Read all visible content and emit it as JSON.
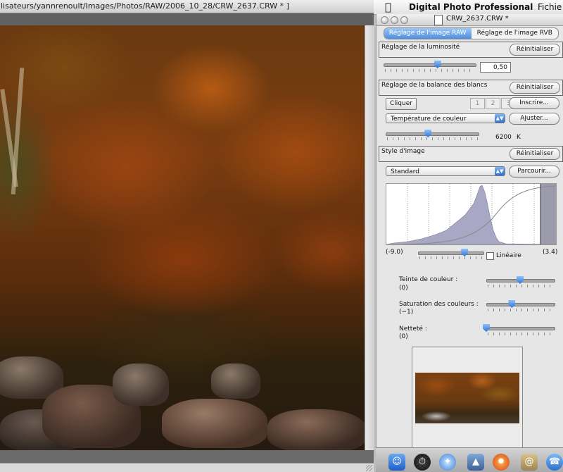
{
  "image_window": {
    "title": "lisateurs/yannrenoult/Images/Photos/RAW/2006_10_28/CRW_2637.CRW * ]"
  },
  "menubar": {
    "app_name": "Digital Photo Professional",
    "file_menu": "Fichie"
  },
  "palette": {
    "title": "CRW_2637.CRW *",
    "tabs": [
      "Réglage de l'image RAW",
      "Réglage de l'image RVB"
    ],
    "active_tab": 0,
    "brightness": {
      "label": "Réglage de la luminosité",
      "reset": "Réinitialiser",
      "value": "0,50",
      "slider_fraction": 0.59
    },
    "white_balance": {
      "label": "Réglage de la balance des blancs",
      "reset": "Réinitialiser",
      "click": "Cliquer",
      "presets": [
        "1",
        "2",
        "3"
      ],
      "register": "Inscrire...",
      "mode": "Température de couleur",
      "adjust": "Ajuster...",
      "kelvin_value": "6200",
      "kelvin_unit": "K",
      "slider_fraction": 0.46
    },
    "picture_style": {
      "label": "Style d'image",
      "reset": "Réinitialiser",
      "style": "Standard",
      "browse": "Parcourir..."
    },
    "histogram": {
      "left_value": "(-9.0)",
      "right_value": "(3.4)",
      "linear_label": "Linéaire",
      "linear_checked": false,
      "slider_fraction": 0.72
    },
    "adjustments": [
      {
        "label": "Teinte de couleur :",
        "value": "(0)",
        "slider_fraction": 0.5
      },
      {
        "label": "Saturation des couleurs :",
        "value": "(−1)",
        "slider_fraction": 0.38
      },
      {
        "label": "Netteté :",
        "value": "(0)",
        "slider_fraction": 0.0
      }
    ]
  },
  "colors": {
    "accent": "#3f82dc",
    "panel_bg": "#e6e6e6"
  },
  "dock": {
    "icons": [
      "finder-icon",
      "dashboard-icon",
      "safari-icon",
      "preview-icon",
      "firefox-icon",
      "mail-icon",
      "ichat-icon"
    ]
  }
}
